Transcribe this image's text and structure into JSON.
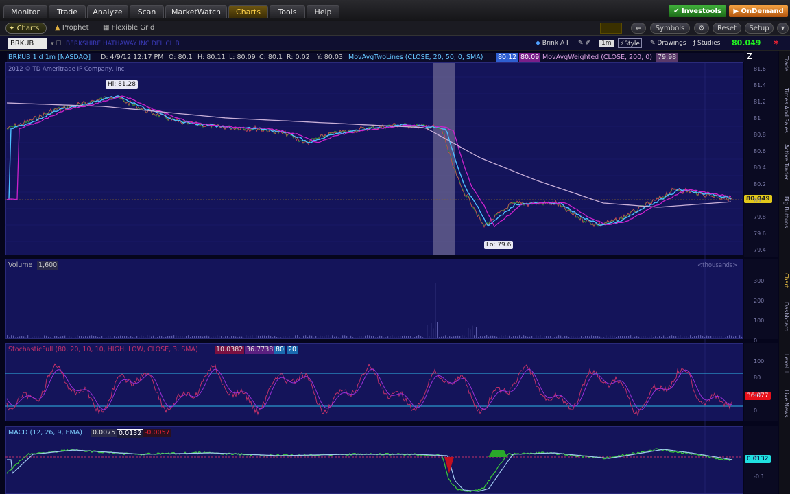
{
  "main_tabs": [
    {
      "label": "Monitor"
    },
    {
      "label": "Trade"
    },
    {
      "label": "Analyze"
    },
    {
      "label": "Scan"
    },
    {
      "label": "MarketWatch"
    },
    {
      "label": "Charts"
    },
    {
      "label": "Tools"
    },
    {
      "label": "Help"
    }
  ],
  "active_tab": "Charts",
  "investools_label": "Investools",
  "ondemand_label": "OnDemand",
  "subtoolbar": {
    "charts": "Charts",
    "prophet": "Prophet",
    "flexible_grid": "Flexible Grid",
    "symbols": "Symbols",
    "reset": "Reset",
    "setup": "Setup"
  },
  "symbol": "BRKUB",
  "company": "BERKSHIRE HATHAWAY INC DEL CL B",
  "toolbar3": {
    "link": "Brink A I",
    "style": "Style",
    "drawings": "Drawings",
    "studies": "Studies",
    "last_price": "80.049"
  },
  "quote": {
    "aggregation": "BRKUB 1 d 1m [NASDAQ]",
    "date": "D: 4/9/12 12:17 PM",
    "open": "O: 80.1",
    "high": "H: 80.11",
    "low": "L: 80.09",
    "close": "C: 80.1",
    "range": "R: 0.02",
    "last": "Y: 80.03",
    "ma_label": "MovAvgTwoLines (CLOSE, 20, 50, 0, SMA)",
    "ma_val1": "80.12",
    "ma_val2": "80.09",
    "maw_label": "MovAvgWeighted (CLOSE, 200, 0)",
    "maw_val": "79.98"
  },
  "copyright": "2012 © TD Ameritrade IP Company, Inc.",
  "price_panel": {
    "high_label": "Hi: 81.28",
    "low_label": "Lo: 79.6",
    "current_tag": "80.049",
    "ticks": [
      "81.6",
      "81.4",
      "81.2",
      "81",
      "80.8",
      "80.6",
      "80.4",
      "80.2",
      "80",
      "79.8",
      "79.6",
      "79.4"
    ]
  },
  "volume_panel": {
    "label": "Volume",
    "value": "1,600",
    "units": "<thousands>",
    "ticks": [
      "300",
      "200",
      "100",
      "0"
    ]
  },
  "stoch_panel": {
    "label": "StochasticFull (80, 20, 10, 10, HIGH, LOW, CLOSE, 3, SMA)",
    "v1": "10.0382",
    "v2": "36.7738",
    "v3": "80",
    "v4": "20",
    "ticks": [
      "100",
      "80",
      "20",
      "0"
    ],
    "tag": "36.077"
  },
  "macd_panel": {
    "label": "MACD (12, 26, 9, EMA)",
    "v1": "0.0075",
    "v2": "0.0132",
    "v3": "-0.0057",
    "tag": "0.0132",
    "ticks": [
      "0",
      "-0.1"
    ]
  },
  "side_tabs": [
    {
      "label": "Trade"
    },
    {
      "label": "Times And Sales"
    },
    {
      "label": "Active Trader"
    },
    {
      "label": "Big Buttons"
    },
    {
      "label": "Chart"
    },
    {
      "label": "Dashboard"
    },
    {
      "label": "Level II"
    },
    {
      "label": "Live News"
    }
  ],
  "colors": {
    "panel_bg": "#14145a",
    "accent": "#ffd24a",
    "price_line": "#4cc0ff",
    "ma_magenta": "#cc22cc",
    "ma_slow": "#c9b0d8"
  },
  "icons": [
    "chart-icon",
    "prophet-icon",
    "grid-icon",
    "link-icon",
    "pencil-icon",
    "style-icon",
    "zoom-icon"
  ]
}
